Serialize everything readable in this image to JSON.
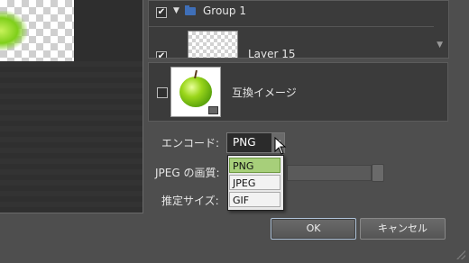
{
  "layers_panel": {
    "group": {
      "checked": true,
      "label": "Group 1"
    },
    "layer": {
      "checked": true,
      "label": "Layer 15"
    }
  },
  "compat_image": {
    "checked": false,
    "label": "互換イメージ"
  },
  "form": {
    "encode_label": "エンコード:",
    "encode_value": "PNG",
    "jpeg_quality_label": "JPEG の画質:",
    "estimated_size_label": "推定サイズ:"
  },
  "dropdown": {
    "options": [
      "PNG",
      "JPEG",
      "GIF"
    ],
    "selected": "PNG"
  },
  "buttons": {
    "ok": "OK",
    "cancel": "キャンセル"
  },
  "icons": {
    "check": "✔",
    "triangle": "▼",
    "scroll_down": "▼",
    "combo_arrow": "▼"
  }
}
